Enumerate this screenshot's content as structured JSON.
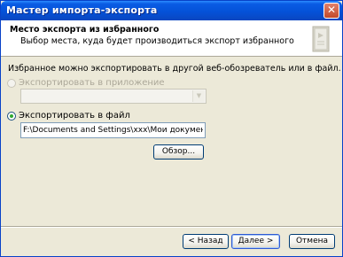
{
  "window": {
    "title": "Мастер импорта-экспорта",
    "close_label": "✕"
  },
  "header": {
    "title": "Место экспорта из избранного",
    "subtitle": "Выбор места, куда будет производиться экспорт избранного"
  },
  "body": {
    "description": "Избранное можно экспортировать в другой веб-обозреватель или в файл.",
    "option_app": {
      "label": "Экспортировать в приложение",
      "selected": false,
      "enabled": false
    },
    "app_combo": {
      "value": ""
    },
    "option_file": {
      "label": "Экспортировать в файл",
      "selected": true
    },
    "file_path": "F:\\Documents and Settings\\xxx\\Мои документы\\bookmark.htm",
    "browse_label": "Обзор..."
  },
  "footer": {
    "back_label": "< Назад",
    "next_label": "Далее >",
    "cancel_label": "Отмена"
  }
}
